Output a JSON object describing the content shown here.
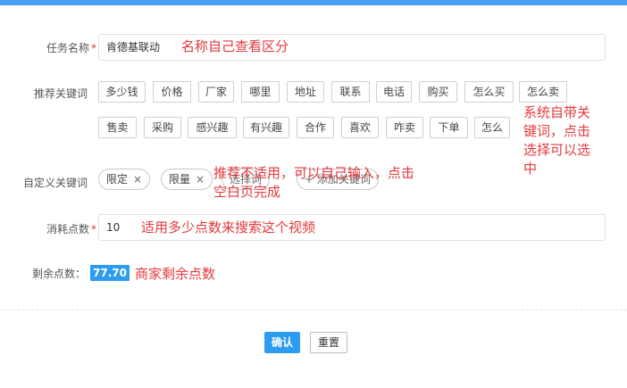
{
  "form": {
    "task_name": {
      "label": "任务名称",
      "required_mark": "*",
      "value": "肯德基联动"
    },
    "recommended": {
      "label": "推荐关键词",
      "row1": [
        "多少钱",
        "价格",
        "厂家",
        "哪里",
        "地址",
        "联系",
        "电话",
        "购买",
        "怎么买",
        "怎么卖"
      ],
      "row2": [
        "售卖",
        "采购",
        "感兴趣",
        "有兴趣",
        "合作",
        "喜欢",
        "咋卖",
        "下单",
        "怎么"
      ]
    },
    "custom": {
      "label": "自定义关键词",
      "tags": [
        "限定",
        "限量"
      ],
      "tag_close": "×",
      "tag3_visible": "选择词",
      "add_visible": "+ 添加关键词"
    },
    "points": {
      "label": "消耗点数",
      "required_mark": "*",
      "value": "10"
    },
    "remaining": {
      "label": "剩余点数：",
      "value": "77.70"
    }
  },
  "annotations": {
    "task_name_note": "名称自己查看区分",
    "system_note_lines": [
      "系统自带关",
      "键词，点击",
      "选择可以选",
      "中"
    ],
    "custom_note_lines": [
      "推荐不适用，可以自己输入，点击",
      "空白页完成"
    ],
    "points_note": "适用多少点数来搜索这个视频",
    "remaining_note": "商家剩余点数"
  },
  "buttons": {
    "confirm": "确认",
    "reset": "重置"
  },
  "colors": {
    "accent": "#2d9cf0",
    "note_red": "#e4393c",
    "top_bar": "#4a9ff5"
  }
}
